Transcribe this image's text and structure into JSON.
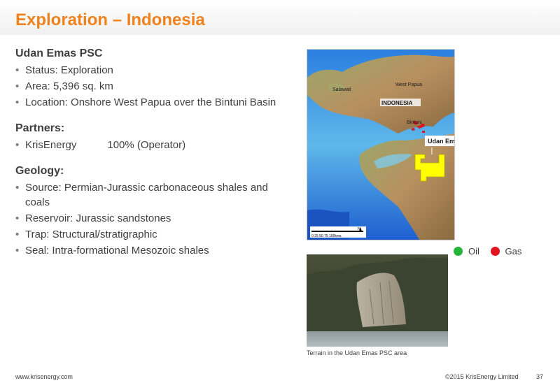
{
  "title": "Exploration – Indonesia",
  "psc": {
    "heading": "Udan Emas PSC",
    "bullets": [
      "Status: Exploration",
      "Area: 5,396 sq. km",
      "Location: Onshore West Papua over the Bintuni Basin"
    ]
  },
  "partners": {
    "heading": "Partners:",
    "rows": [
      {
        "name": "KrisEnergy",
        "pct": "100% (Operator)"
      }
    ]
  },
  "geology": {
    "heading": "Geology:",
    "bullets": [
      "Source: Permian-Jurassic carbonaceous shales and coals",
      "Reservoir: Jurassic sandstones",
      "Trap: Structural/stratigraphic",
      "Seal: Intra-formational Mesozoic shales"
    ]
  },
  "map": {
    "labels": {
      "salawati": "Salawati",
      "west_papua": "West Papua",
      "indonesia": "INDONESIA",
      "bintuni": "Bintuni",
      "udan_emas": "Udan Emas"
    },
    "scale_text": "0  25  50  75 100kms",
    "north": "N",
    "colors": {
      "sea_deep": "#1e5fd0",
      "sea_light": "#8fd2ea",
      "land": "#b08a55",
      "block": "#ffff00",
      "gas": "#e0141e",
      "oil": "#27b43a"
    }
  },
  "legend": [
    {
      "label": "Oil",
      "color": "#27b43a"
    },
    {
      "label": "Gas",
      "color": "#e0141e"
    }
  ],
  "photo_caption": "Terrain in the Udan Emas PSC area",
  "footer": {
    "website": "www.krisenergy.com",
    "copyright": "©2015 KrisEnergy Limited",
    "page": "37"
  }
}
